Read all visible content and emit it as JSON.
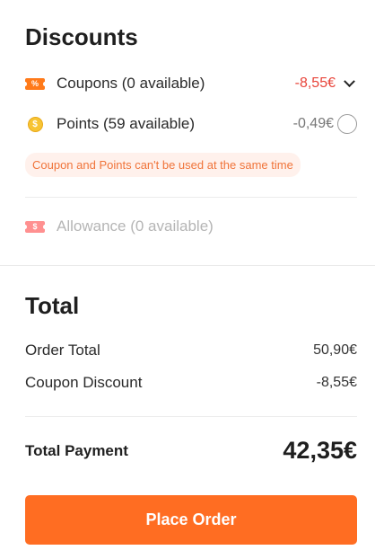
{
  "discounts": {
    "title": "Discounts",
    "coupons": {
      "icon": "coupon-percent-icon",
      "icon_glyph": "%",
      "label": "Coupons (0 available)",
      "value": "-8,55€",
      "value_color": "#e8443a"
    },
    "points": {
      "icon": "coin-dollar-icon",
      "icon_glyph": "$",
      "label": "Points (59 available)",
      "value": "-0,49€",
      "selected": false
    },
    "notice": "Coupon and Points can't be used at the same time",
    "allowance": {
      "icon": "allowance-dollar-icon",
      "icon_glyph": "$",
      "label": "Allowance (0 available)",
      "disabled": true
    }
  },
  "total": {
    "title": "Total",
    "order_total_label": "Order Total",
    "order_total_value": "50,90€",
    "coupon_discount_label": "Coupon Discount",
    "coupon_discount_value": "-8,55€",
    "payment_label": "Total Payment",
    "payment_value": "42,35€"
  },
  "actions": {
    "place_order_label": "Place Order",
    "accent_color": "#ff6d22"
  }
}
